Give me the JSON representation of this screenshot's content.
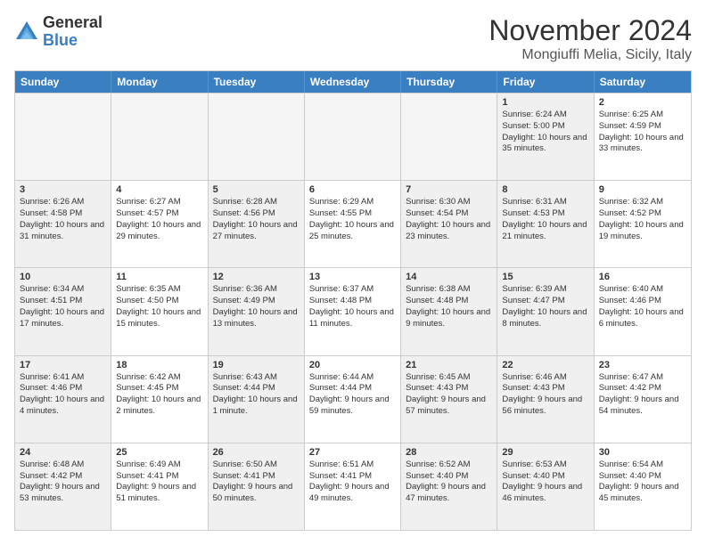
{
  "header": {
    "logo_general": "General",
    "logo_blue": "Blue",
    "month_title": "November 2024",
    "location": "Mongiuffi Melia, Sicily, Italy"
  },
  "days_of_week": [
    "Sunday",
    "Monday",
    "Tuesday",
    "Wednesday",
    "Thursday",
    "Friday",
    "Saturday"
  ],
  "rows": [
    [
      {
        "day": "",
        "info": "",
        "empty": true
      },
      {
        "day": "",
        "info": "",
        "empty": true
      },
      {
        "day": "",
        "info": "",
        "empty": true
      },
      {
        "day": "",
        "info": "",
        "empty": true
      },
      {
        "day": "",
        "info": "",
        "empty": true
      },
      {
        "day": "1",
        "info": "Sunrise: 6:24 AM\nSunset: 5:00 PM\nDaylight: 10 hours\nand 35 minutes.",
        "shaded": true
      },
      {
        "day": "2",
        "info": "Sunrise: 6:25 AM\nSunset: 4:59 PM\nDaylight: 10 hours\nand 33 minutes.",
        "shaded": false
      }
    ],
    [
      {
        "day": "3",
        "info": "Sunrise: 6:26 AM\nSunset: 4:58 PM\nDaylight: 10 hours\nand 31 minutes.",
        "shaded": true
      },
      {
        "day": "4",
        "info": "Sunrise: 6:27 AM\nSunset: 4:57 PM\nDaylight: 10 hours\nand 29 minutes.",
        "shaded": false
      },
      {
        "day": "5",
        "info": "Sunrise: 6:28 AM\nSunset: 4:56 PM\nDaylight: 10 hours\nand 27 minutes.",
        "shaded": true
      },
      {
        "day": "6",
        "info": "Sunrise: 6:29 AM\nSunset: 4:55 PM\nDaylight: 10 hours\nand 25 minutes.",
        "shaded": false
      },
      {
        "day": "7",
        "info": "Sunrise: 6:30 AM\nSunset: 4:54 PM\nDaylight: 10 hours\nand 23 minutes.",
        "shaded": true
      },
      {
        "day": "8",
        "info": "Sunrise: 6:31 AM\nSunset: 4:53 PM\nDaylight: 10 hours\nand 21 minutes.",
        "shaded": true
      },
      {
        "day": "9",
        "info": "Sunrise: 6:32 AM\nSunset: 4:52 PM\nDaylight: 10 hours\nand 19 minutes.",
        "shaded": false
      }
    ],
    [
      {
        "day": "10",
        "info": "Sunrise: 6:34 AM\nSunset: 4:51 PM\nDaylight: 10 hours\nand 17 minutes.",
        "shaded": true
      },
      {
        "day": "11",
        "info": "Sunrise: 6:35 AM\nSunset: 4:50 PM\nDaylight: 10 hours\nand 15 minutes.",
        "shaded": false
      },
      {
        "day": "12",
        "info": "Sunrise: 6:36 AM\nSunset: 4:49 PM\nDaylight: 10 hours\nand 13 minutes.",
        "shaded": true
      },
      {
        "day": "13",
        "info": "Sunrise: 6:37 AM\nSunset: 4:48 PM\nDaylight: 10 hours\nand 11 minutes.",
        "shaded": false
      },
      {
        "day": "14",
        "info": "Sunrise: 6:38 AM\nSunset: 4:48 PM\nDaylight: 10 hours\nand 9 minutes.",
        "shaded": true
      },
      {
        "day": "15",
        "info": "Sunrise: 6:39 AM\nSunset: 4:47 PM\nDaylight: 10 hours\nand 8 minutes.",
        "shaded": true
      },
      {
        "day": "16",
        "info": "Sunrise: 6:40 AM\nSunset: 4:46 PM\nDaylight: 10 hours\nand 6 minutes.",
        "shaded": false
      }
    ],
    [
      {
        "day": "17",
        "info": "Sunrise: 6:41 AM\nSunset: 4:46 PM\nDaylight: 10 hours\nand 4 minutes.",
        "shaded": true
      },
      {
        "day": "18",
        "info": "Sunrise: 6:42 AM\nSunset: 4:45 PM\nDaylight: 10 hours\nand 2 minutes.",
        "shaded": false
      },
      {
        "day": "19",
        "info": "Sunrise: 6:43 AM\nSunset: 4:44 PM\nDaylight: 10 hours\nand 1 minute.",
        "shaded": true
      },
      {
        "day": "20",
        "info": "Sunrise: 6:44 AM\nSunset: 4:44 PM\nDaylight: 9 hours\nand 59 minutes.",
        "shaded": false
      },
      {
        "day": "21",
        "info": "Sunrise: 6:45 AM\nSunset: 4:43 PM\nDaylight: 9 hours\nand 57 minutes.",
        "shaded": true
      },
      {
        "day": "22",
        "info": "Sunrise: 6:46 AM\nSunset: 4:43 PM\nDaylight: 9 hours\nand 56 minutes.",
        "shaded": true
      },
      {
        "day": "23",
        "info": "Sunrise: 6:47 AM\nSunset: 4:42 PM\nDaylight: 9 hours\nand 54 minutes.",
        "shaded": false
      }
    ],
    [
      {
        "day": "24",
        "info": "Sunrise: 6:48 AM\nSunset: 4:42 PM\nDaylight: 9 hours\nand 53 minutes.",
        "shaded": true
      },
      {
        "day": "25",
        "info": "Sunrise: 6:49 AM\nSunset: 4:41 PM\nDaylight: 9 hours\nand 51 minutes.",
        "shaded": false
      },
      {
        "day": "26",
        "info": "Sunrise: 6:50 AM\nSunset: 4:41 PM\nDaylight: 9 hours\nand 50 minutes.",
        "shaded": true
      },
      {
        "day": "27",
        "info": "Sunrise: 6:51 AM\nSunset: 4:41 PM\nDaylight: 9 hours\nand 49 minutes.",
        "shaded": false
      },
      {
        "day": "28",
        "info": "Sunrise: 6:52 AM\nSunset: 4:40 PM\nDaylight: 9 hours\nand 47 minutes.",
        "shaded": true
      },
      {
        "day": "29",
        "info": "Sunrise: 6:53 AM\nSunset: 4:40 PM\nDaylight: 9 hours\nand 46 minutes.",
        "shaded": true
      },
      {
        "day": "30",
        "info": "Sunrise: 6:54 AM\nSunset: 4:40 PM\nDaylight: 9 hours\nand 45 minutes.",
        "shaded": false
      }
    ]
  ]
}
